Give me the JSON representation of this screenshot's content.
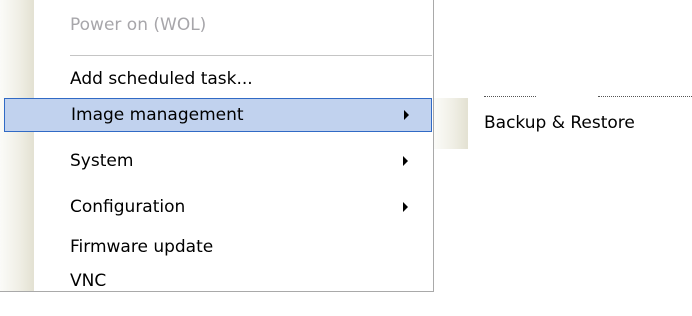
{
  "context_menu": {
    "items": [
      {
        "label": "Power on (WOL)",
        "disabled": true,
        "has_submenu": false
      },
      {
        "label": "Add scheduled task...",
        "disabled": false,
        "has_submenu": false
      },
      {
        "label": "Image management",
        "disabled": false,
        "has_submenu": true,
        "selected": true
      },
      {
        "label": "System",
        "disabled": false,
        "has_submenu": true
      },
      {
        "label": "Configuration",
        "disabled": false,
        "has_submenu": true
      },
      {
        "label": "Firmware update",
        "disabled": false,
        "has_submenu": false
      },
      {
        "label": "VNC",
        "disabled": false,
        "has_submenu": false
      }
    ]
  },
  "submenu": {
    "items": [
      {
        "label": "Backup & Restore"
      }
    ]
  },
  "colors": {
    "selection_fill": "#c1d2ee",
    "selection_border": "#316ac5",
    "disabled_text": "#a7a6aa"
  }
}
